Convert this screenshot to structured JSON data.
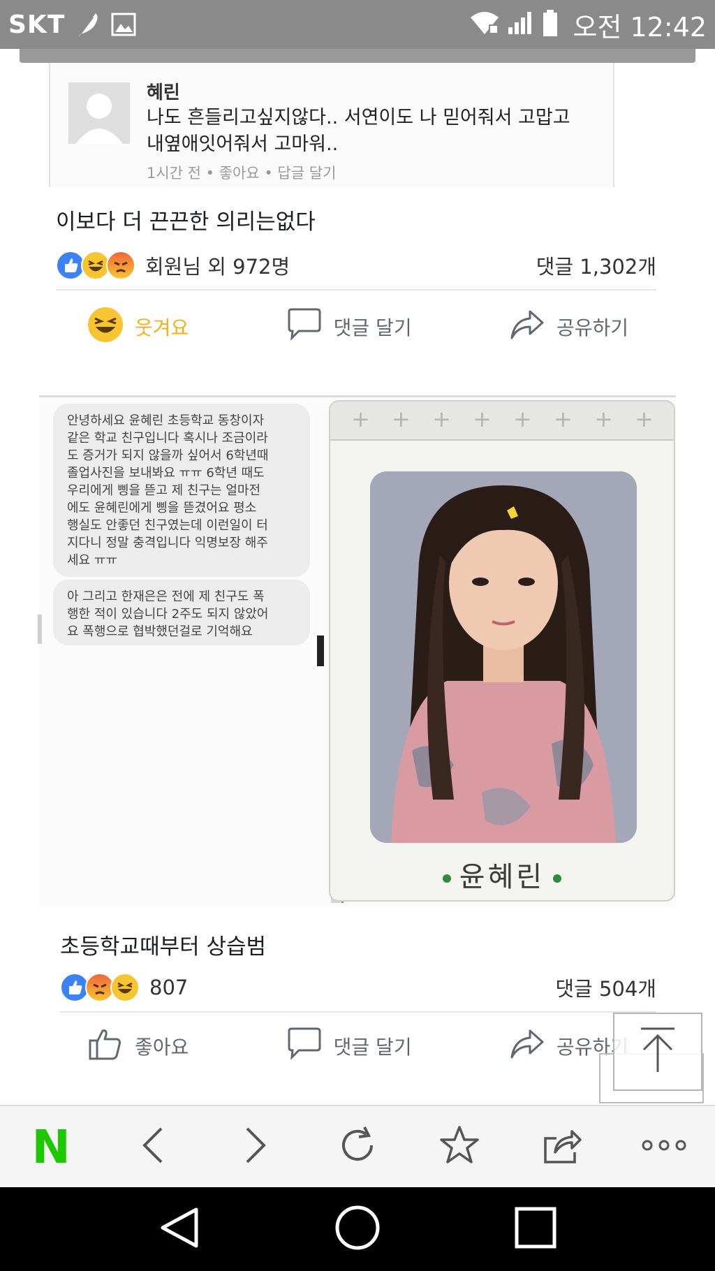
{
  "status_bar": {
    "carrier": "SKT",
    "clock": "오전 12:42"
  },
  "comment": {
    "author": "혜린",
    "text": "나도 흔들리고싶지않다.. 서연이도 나 믿어줘서 고맙고\n내옆애잇어줘서 고마워..",
    "meta": "1시간 전 • 좋아요 • 답글 달기"
  },
  "post1": {
    "caption": "이보다 더 끈끈한 의리는없다",
    "reaction_summary": "회원님 외 972명",
    "comment_count": "댓글 1,302개",
    "actions": {
      "react_label": "웃겨요",
      "comment_label": "댓글 달기",
      "share_label": "공유하기"
    }
  },
  "embed": {
    "message1": "안녕하세요 윤혜린 초등학교 동창이자\n같은 학교 친구입니다 혹시나 조금이라\n도 증거가 되지 않을까 싶어서 6학년때\n졸업사진을 보내봐요 ㅠㅠ 6학년 때도\n우리에게 삥을 뜯고 제 친구는 얼마전\n에도 윤혜린에게 삥을 뜯겼어요 평소\n행실도 안좋던 친구였는데 이런일이 터\n지다니 정말 충격입니다 익명보장 해주\n세요 ㅠㅠ",
    "message2": "아 그리고 한재은은 전에 제 친구도 폭\n행한 적이 있습니다 2주도 되지 않았어\n요 폭행으로 협박했던걸로 기억해요",
    "yearbook_name": "윤혜린"
  },
  "post2": {
    "caption": "초등학교때부터 상습범",
    "reaction_count": "807",
    "comment_count": "댓글 504개",
    "actions": {
      "like_label": "좋아요",
      "comment_label": "댓글 달기",
      "share_label": "공유하기"
    }
  },
  "browser_bar": {
    "logo": "N"
  },
  "colors": {
    "status_bar": "#8a8a8a",
    "like_blue": "#3b82f6",
    "haha_yellow": "#f7c531",
    "angry_orange": "#f0663a",
    "naver_green": "#1ec800"
  },
  "icons": [
    "wifi-icon",
    "signal-icon",
    "battery-icon",
    "back-icon",
    "forward-icon",
    "refresh-icon",
    "star-icon",
    "share-icon",
    "more-icon",
    "nav-back-icon",
    "nav-home-icon",
    "nav-recents-icon"
  ]
}
